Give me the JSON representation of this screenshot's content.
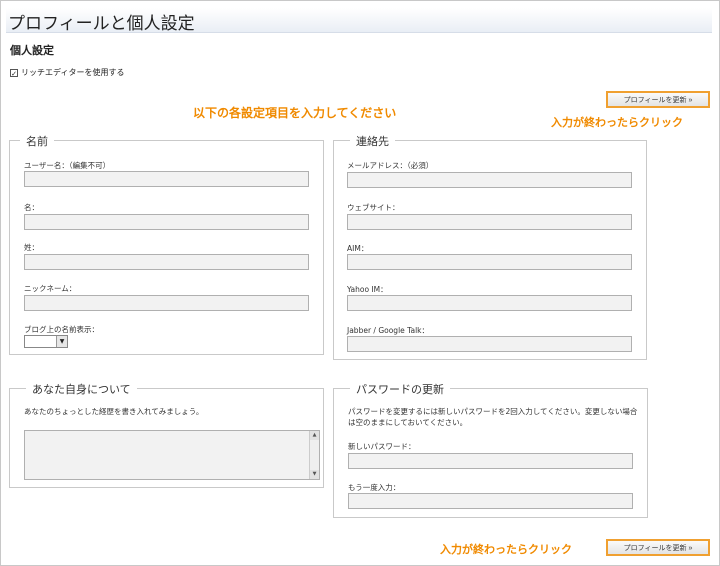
{
  "page": {
    "title": "プロフィールと個人設定"
  },
  "personal": {
    "heading": "個人設定",
    "rich_editor_label": "リッチエディターを使用する",
    "rich_editor_checked": true
  },
  "instruction": "以下の各設定項目を入力してください",
  "callouts": {
    "top": "入力が終わったらクリック",
    "bottom": "入力が終わったらクリック"
  },
  "buttons": {
    "update_profile": "プロフィールを更新 »"
  },
  "name_group": {
    "legend": "名前",
    "username_label": "ユーザー名：（編集不可）",
    "first_name_label": "名：",
    "last_name_label": "姓：",
    "nickname_label": "ニックネーム：",
    "display_name_label": "ブログ上の名前表示："
  },
  "contact_group": {
    "legend": "連絡先",
    "email_label": "メールアドレス：（必須）",
    "website_label": "ウェブサイト：",
    "aim_label": "AIM：",
    "yahoo_label": "Yahoo IM：",
    "jabber_label": "Jabber / Google Talk："
  },
  "about_group": {
    "legend": "あなた自身について",
    "description": "あなたのちょっとした経歴を書き入れてみましょう。"
  },
  "password_group": {
    "legend": "パスワードの更新",
    "description_line1": "パスワードを変更するには新しいパスワードを2回入力してください。変更しない場合",
    "description_line2": "は空のままにしておいてください。",
    "new_password_label": "新しいパスワード：",
    "confirm_password_label": "もう一度入力："
  },
  "colors": {
    "accent": "#f08a00",
    "button_border": "#f0a030"
  },
  "icons": {
    "checkbox": "check-icon",
    "select_arrow": "chevron-down-icon",
    "scroll_up": "arrow-up-icon",
    "scroll_down": "arrow-down-icon"
  }
}
